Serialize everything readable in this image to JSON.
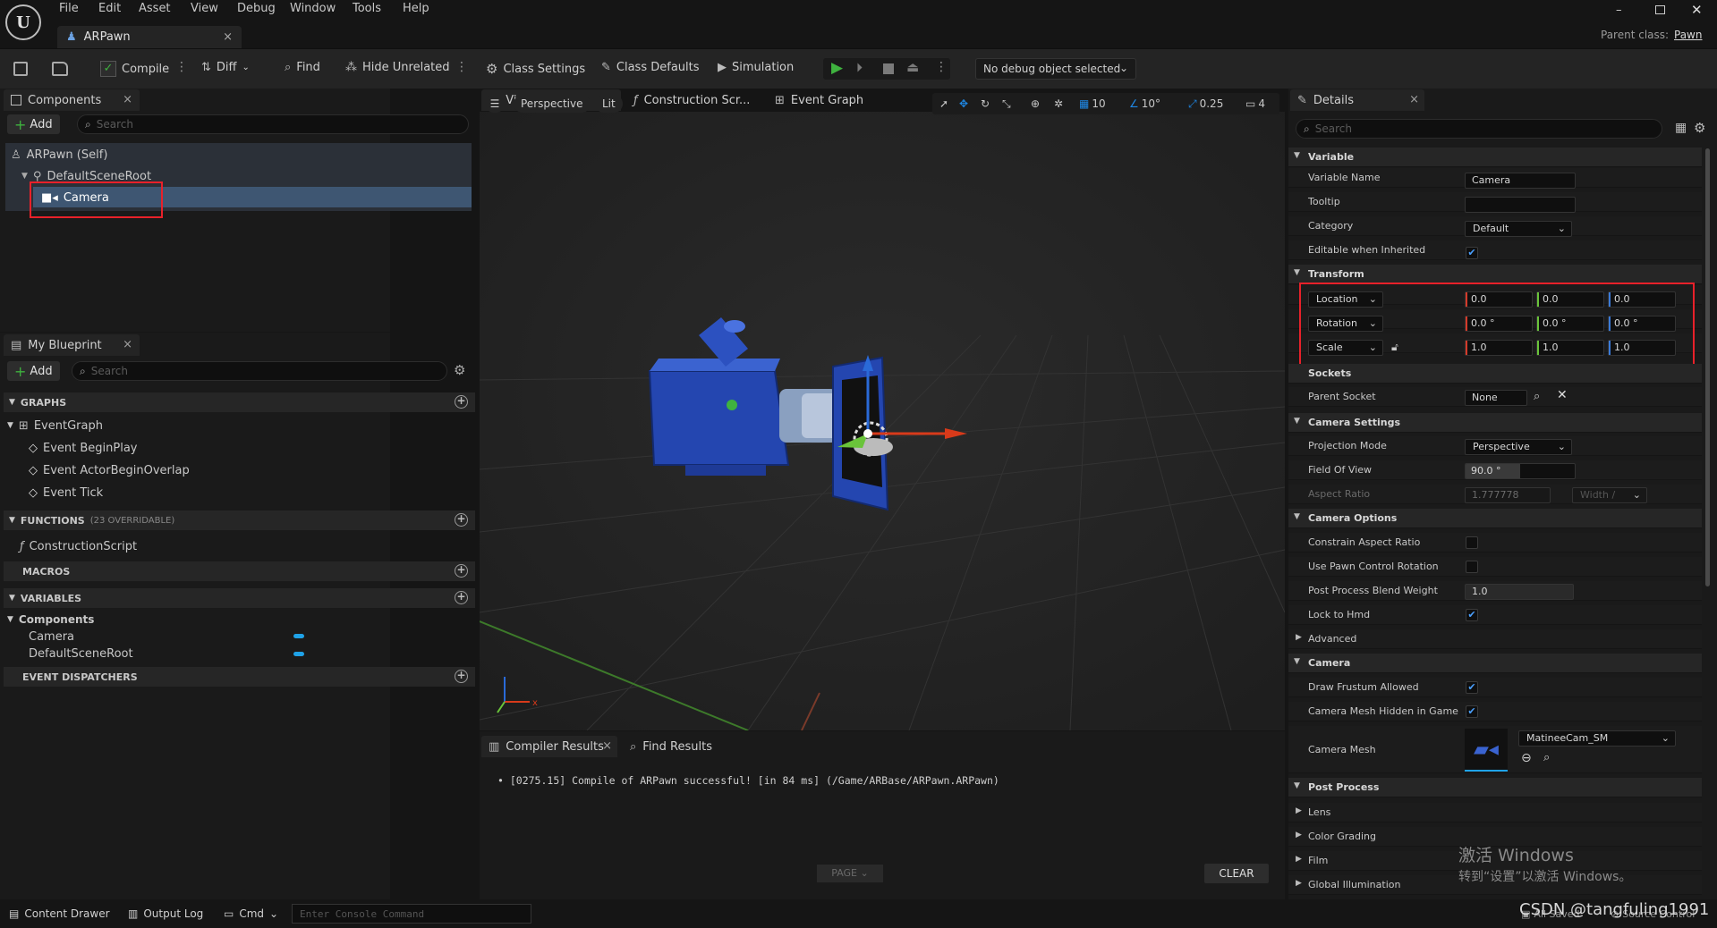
{
  "menu": {
    "items": [
      "File",
      "Edit",
      "Asset",
      "View",
      "Debug",
      "Window",
      "Tools",
      "Help"
    ]
  },
  "doc_tab": {
    "label": "ARPawn"
  },
  "parent_class": {
    "label": "Parent class:",
    "value": "Pawn"
  },
  "toolbar": {
    "compile": "Compile",
    "diff": "Diff",
    "find": "Find",
    "hide_unrelated": "Hide Unrelated",
    "class_settings": "Class Settings",
    "class_defaults": "Class Defaults",
    "simulation": "Simulation",
    "debug_object": "No debug object selected"
  },
  "components": {
    "tab": "Components",
    "add": "Add",
    "search_placeholder": "Search",
    "tree": [
      "ARPawn (Self)",
      "DefaultSceneRoot",
      "Camera"
    ]
  },
  "my_blueprint": {
    "tab": "My Blueprint",
    "add": "Add",
    "search_placeholder": "Search",
    "graphs_header": "GRAPHS",
    "event_graph": "EventGraph",
    "events": [
      "Event BeginPlay",
      "Event ActorBeginOverlap",
      "Event Tick"
    ],
    "functions_header": "FUNCTIONS",
    "functions_note": "(23 OVERRIDABLE)",
    "construction_script": "ConstructionScript",
    "macros_header": "MACROS",
    "variables_header": "VARIABLES",
    "components_group": "Components",
    "variables": [
      "Camera",
      "DefaultSceneRoot"
    ],
    "dispatchers_header": "EVENT DISPATCHERS",
    "var_color": "#1fa2e8"
  },
  "viewport": {
    "tabs": [
      "Viewport",
      "Construction Scr...",
      "Event Graph"
    ],
    "perspective": "Perspective",
    "lit": "Lit",
    "grid_snap": "10",
    "rot_snap": "10°",
    "scale_snap": "0.25",
    "cam_speed": "4"
  },
  "compiler": {
    "tabs": [
      "Compiler Results",
      "Find Results"
    ],
    "message": "[0275.15] Compile of ARPawn successful! [in 84 ms] (/Game/ARBase/ARPawn.ARPawn)",
    "page": "PAGE",
    "clear": "CLEAR"
  },
  "details": {
    "tab": "Details",
    "search_placeholder": "Search",
    "variable": {
      "header": "Variable",
      "name_label": "Variable Name",
      "name_value": "Camera",
      "tooltip_label": "Tooltip",
      "tooltip_value": "",
      "category_label": "Category",
      "category_value": "Default",
      "editable_label": "Editable when Inherited"
    },
    "transform": {
      "header": "Transform",
      "location": "Location",
      "rotation": "Rotation",
      "scale": "Scale",
      "loc": [
        "0.0",
        "0.0",
        "0.0"
      ],
      "rot": [
        "0.0 °",
        "0.0 °",
        "0.0 °"
      ],
      "scl": [
        "1.0",
        "1.0",
        "1.0"
      ]
    },
    "sockets": {
      "header": "Sockets",
      "parent_label": "Parent Socket",
      "parent_value": "None"
    },
    "camera_settings": {
      "header": "Camera Settings",
      "projection_label": "Projection Mode",
      "projection_value": "Perspective",
      "fov_label": "Field Of View",
      "fov_value": "90.0 °",
      "fov_fraction": 0.5,
      "aspect_label": "Aspect Ratio",
      "aspect_value": "1.777778",
      "aspect_combo": "Width /"
    },
    "camera_options": {
      "header": "Camera Options",
      "constrain_label": "Constrain Aspect Ratio",
      "pawn_rot_label": "Use Pawn Control Rotation",
      "blend_label": "Post Process Blend Weight",
      "blend_value": "1.0",
      "hmd_label": "Lock to Hmd",
      "advanced_label": "Advanced"
    },
    "camera": {
      "header": "Camera",
      "frustum_label": "Draw Frustum Allowed",
      "hidden_label": "Camera Mesh Hidden in Game",
      "mesh_label": "Camera Mesh",
      "mesh_value": "MatineeCam_SM"
    },
    "post_process": {
      "header": "Post Process",
      "items": [
        "Lens",
        "Color Grading",
        "Film",
        "Global Illumination"
      ]
    }
  },
  "statusbar": {
    "content_drawer": "Content Drawer",
    "output_log": "Output Log",
    "cmd": "Cmd",
    "console_placeholder": "Enter Console Command",
    "all_saved": "All Saved",
    "source_control": "Source Control"
  },
  "watermark": {
    "line1": "激活 Windows",
    "line2": "转到“设置”以激活 Windows。",
    "csdn": "CSDN @tangfuling1991"
  },
  "colors": {
    "highlight": "#e8212a",
    "selection": "#3e5672",
    "accent_blue": "#1f88e5",
    "play_green": "#3fb23f"
  }
}
